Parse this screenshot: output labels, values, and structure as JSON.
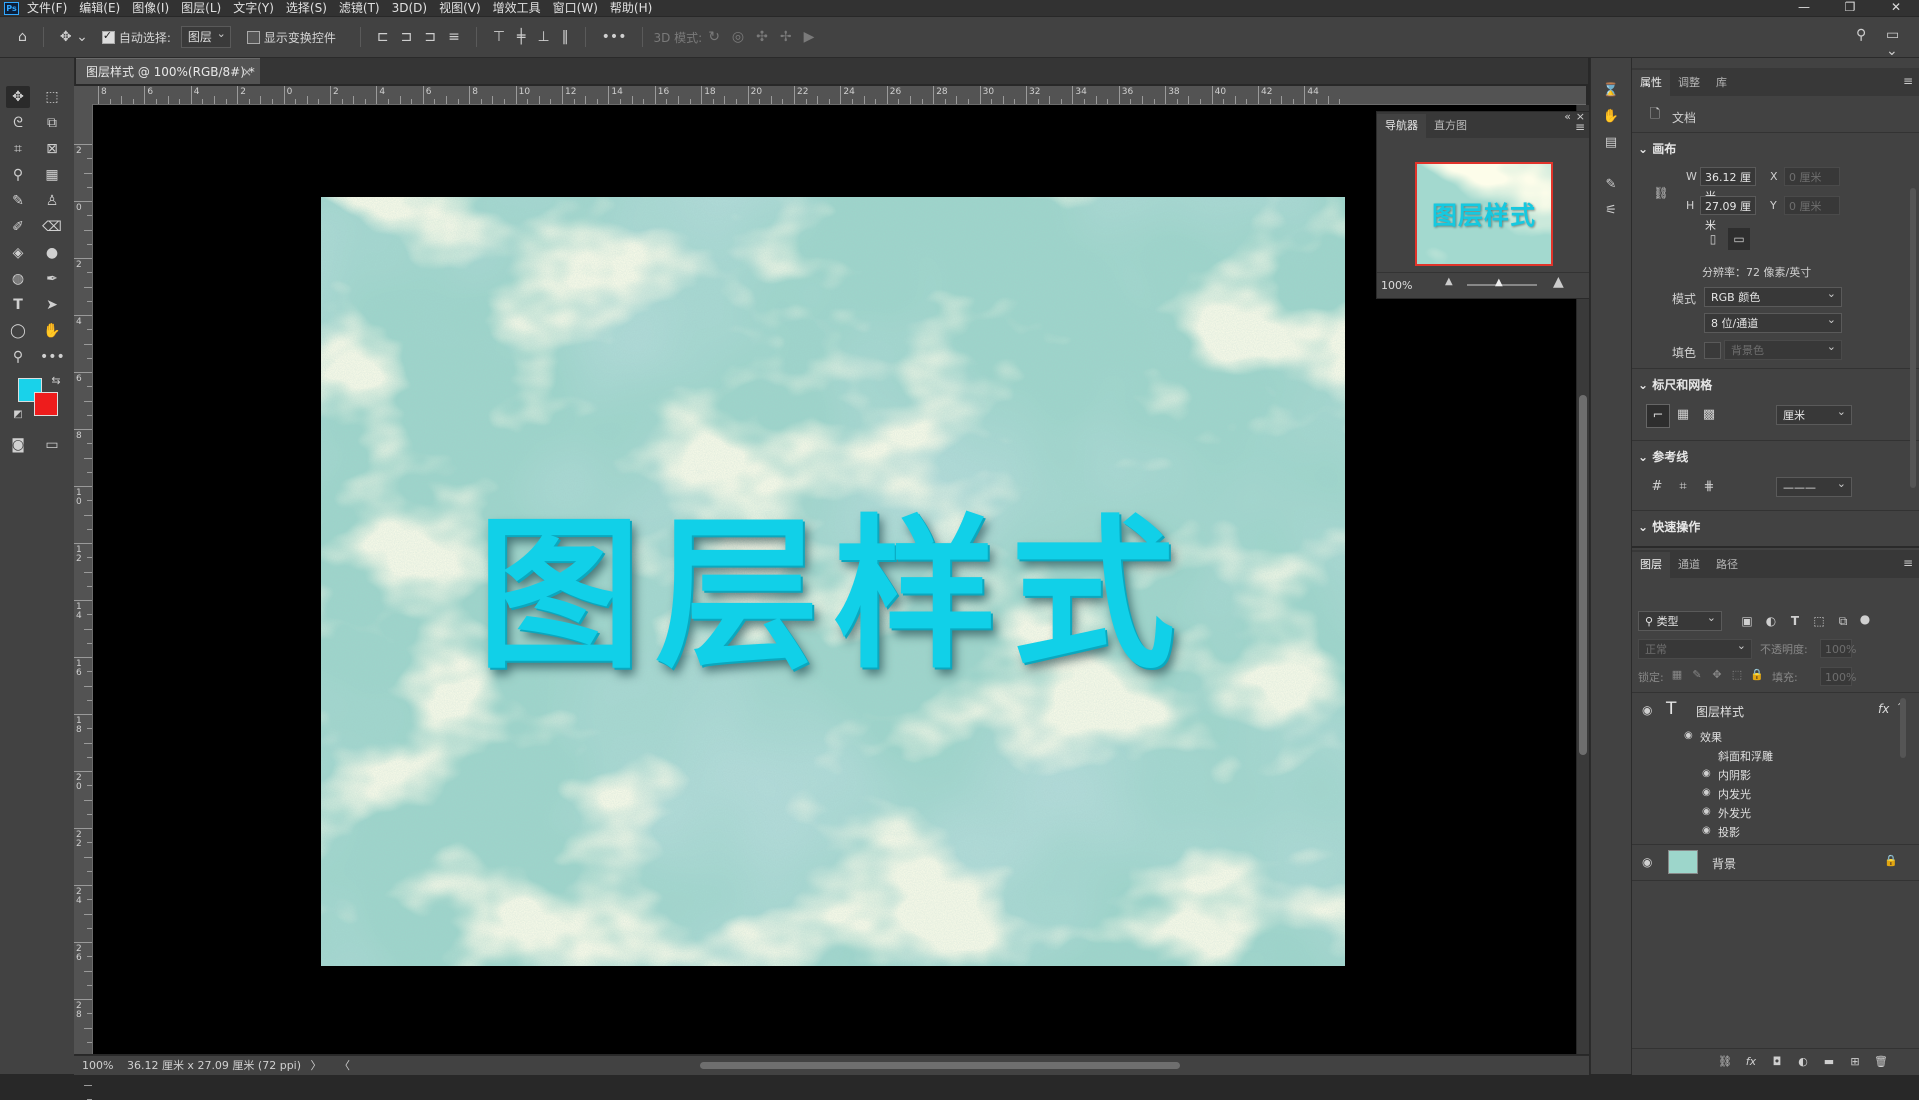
{
  "menu": [
    "文件(F)",
    "编辑(E)",
    "图像(I)",
    "图层(L)",
    "文字(Y)",
    "选择(S)",
    "滤镜(T)",
    "3D(D)",
    "视图(V)",
    "增效工具",
    "窗口(W)",
    "帮助(H)"
  ],
  "app_logo": "Ps",
  "window_controls": [
    "—",
    "❐",
    "✕"
  ],
  "options": {
    "auto_select_label": "自动选择:",
    "auto_select_value": "图层",
    "show_transform_label": "显示变换控件",
    "mode3d_label": "3D 模式:",
    "more": "•••"
  },
  "document": {
    "tab_title": "图层样式 @ 100%(RGB/8#) *",
    "close": "×",
    "canvas_text": "图层样式",
    "status_zoom": "100%",
    "status_info": "36.12 厘米 x 27.09 厘米 (72 ppi)",
    "status_arrow": "〉",
    "status_left_arrow": "〈"
  },
  "ruler": {
    "h_labels": [
      "8",
      "6",
      "4",
      "2",
      "0",
      "2",
      "4",
      "6",
      "8",
      "10",
      "12",
      "14",
      "16",
      "18",
      "20",
      "22",
      "24",
      "26",
      "28",
      "30",
      "32",
      "34",
      "36",
      "38",
      "40",
      "42",
      "44"
    ],
    "v_labels": [
      "2",
      "0",
      "2",
      "4",
      "6",
      "8",
      "1 0",
      "1 2",
      "1 4",
      "1 6",
      "1 8",
      "2 0",
      "2 2",
      "2 4",
      "2 6",
      "2 8",
      "3"
    ]
  },
  "navigator": {
    "tabs": [
      "导航器",
      "直方图"
    ],
    "zoom": "100%",
    "thumb_text": "图层样式"
  },
  "properties": {
    "tabs": [
      "属性",
      "调整",
      "库"
    ],
    "doc_label": "文档",
    "canvas_section": "画布",
    "w_label": "W",
    "w_value": "36.12 厘米",
    "h_label": "H",
    "h_value": "27.09 厘米",
    "x_label": "X",
    "x_value": "0 厘米",
    "y_label": "Y",
    "y_value": "0 厘米",
    "resolution": "分辨率：72 像素/英寸",
    "mode_label": "模式",
    "mode_value": "RGB 颜色",
    "bits_value": "8 位/通道",
    "fill_label": "填色",
    "fill_value": "背景色",
    "rulers_section": "标尺和网格",
    "unit_value": "厘米",
    "guides_section": "参考线",
    "quick_section": "快速操作"
  },
  "layers": {
    "tabs": [
      "图层",
      "通道",
      "路径"
    ],
    "filter_value": "类型",
    "blend_value": "正常",
    "opacity_label": "不透明度:",
    "opacity_value": "100%",
    "lock_label": "锁定:",
    "fill_label": "填充:",
    "fill_value": "100%",
    "items": [
      {
        "name": "图层样式",
        "fx": "fx"
      },
      {
        "name": "背景"
      }
    ],
    "effects_label": "效果",
    "effects": [
      "斜面和浮雕",
      "内阴影",
      "内发光",
      "外发光",
      "投影"
    ]
  },
  "colors": {
    "foreground": "#19d2ea",
    "background": "#ee1c1c",
    "text_cyan": "#11d0e8",
    "accent_red": "#e0342b"
  }
}
